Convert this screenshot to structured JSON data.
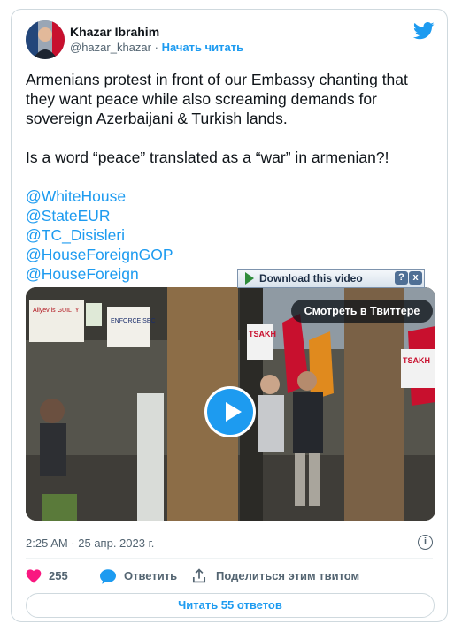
{
  "author": {
    "name": "Khazar Ibrahim",
    "handle": "@hazar_khazar",
    "separator": "·",
    "follow_label": "Начать читать"
  },
  "icons": {
    "brand": "twitter-bird-icon",
    "like": "heart-icon",
    "reply": "speech-bubble-icon",
    "share": "share-upload-icon",
    "info": "info-icon"
  },
  "tweet": {
    "paragraph1": "Armenians protest in front of our Embassy chanting that they want peace while also screaming demands for sovereign Azerbaijani & Turkish lands.",
    "paragraph2": "Is a word “peace” translated as a “war” in armenian?!",
    "mentions": [
      "@WhiteHouse",
      "@StateEUR",
      "@TC_Disisleri",
      "@HouseForeignGOP",
      "@HouseForeign"
    ]
  },
  "media": {
    "download_label": "Download this video",
    "help_label": "?",
    "close_label": "x",
    "watch_label": "Смотреть в Твиттере",
    "signs": {
      "sign1": "Aliyev is GUILTY",
      "sign2": "ENFORCE SEC",
      "sign3": "TSAKH",
      "sign4": "TSAKH"
    }
  },
  "meta": {
    "timestamp": "2:25 AM · 25 апр. 2023 г.",
    "info_label": "i"
  },
  "actions": {
    "likes": "255",
    "reply_label": "Ответить",
    "share_label": "Поделиться этим твитом"
  },
  "read_replies_label": "Читать 55 ответов",
  "colors": {
    "accent": "#1d9bf0",
    "like": "#f91880",
    "text": "#0f1419",
    "secondary": "#536471"
  }
}
